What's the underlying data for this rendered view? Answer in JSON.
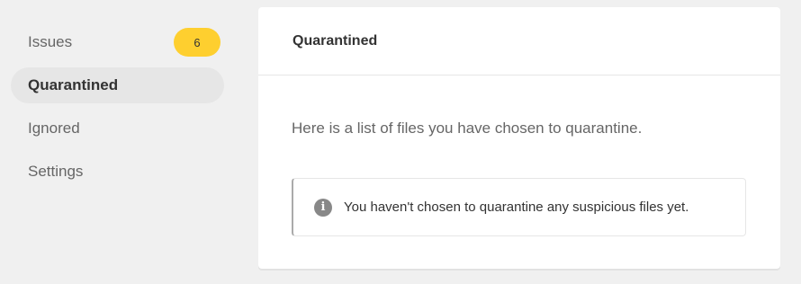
{
  "sidebar": {
    "items": [
      {
        "label": "Issues",
        "badge": "6"
      },
      {
        "label": "Quarantined"
      },
      {
        "label": "Ignored"
      },
      {
        "label": "Settings"
      }
    ]
  },
  "main": {
    "title": "Quarantined",
    "intro": "Here is a list of files you have chosen to quarantine.",
    "notice": {
      "icon": "info-icon",
      "text": "You haven't chosen to quarantine any suspicious files yet."
    }
  },
  "colors": {
    "badge": "#fecf2f",
    "active_item_bg": "#e6e6e6",
    "page_bg": "#f0f0f0"
  }
}
